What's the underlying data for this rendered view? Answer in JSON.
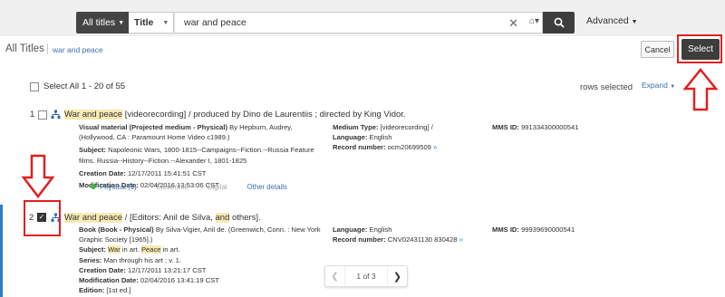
{
  "search": {
    "scope": "All titles",
    "field": "Title",
    "query": "war and peace",
    "advanced": "Advanced"
  },
  "header": {
    "title": "All Titles",
    "breadcrumb": "war and peace",
    "cancel": "Cancel",
    "select": "Select"
  },
  "toolbar": {
    "select_all": "Select All",
    "range": "1 - 20 of 55",
    "rows_selected": "rows selected",
    "expand": "Expand"
  },
  "records": [
    {
      "num": "1",
      "title_hl": "War and peace",
      "title_rest": " [videorecording] / produced by Dino de Laurentiis ; directed by King Vidor.",
      "type_label": "Visual material (Projected medium - Physical)",
      "type_rest": " By Hepburn, Audrey, (Hollywood, CA : Paramount Home Video c1989.)",
      "subject_label": "Subject:",
      "subject": " Napoleonic Wars, 1800-1815--Campaigns--Fiction.--Russia Feature films. Russia--History--Fiction.--Alexander I, 1801-1825",
      "creation_label": "Creation Date:",
      "creation": " 12/17/2011 15:41:51 CST",
      "mod_label": "Modification Date:",
      "mod": " 02/04/2016 13:53:06 CST",
      "medium_label": "Medium Type:",
      "medium": " [videorecording] /",
      "lang_label": "Language:",
      "lang": " English",
      "recnum_label": "Record number:",
      "recnum": " ocm20699509",
      "mms_label": "MMS ID:",
      "mms": " 991334300000541",
      "tab_physical": "Physical (1)",
      "tab_electronic": "Electronic",
      "tab_digital": "Digital",
      "tab_other": "Other details"
    },
    {
      "num": "2",
      "title_hl": "War and peace",
      "title_mid": " / [Editors: Anil de Silva, ",
      "title_and": "and",
      "title_end": " others].",
      "type_label": "Book (Book - Physical)",
      "type_rest": " By Silva-Vigier, Anil de. (Greenwich, Conn. : New York Graphic Society [1965].)",
      "subject_label": "Subject:",
      "subject_war": "War",
      "subject_mid": " in art. ",
      "subject_peace": "Peace",
      "subject_end": " in art.",
      "series_label": "Series:",
      "series": " Man through his art ; v. 1.",
      "creation_label": "Creation Date:",
      "creation": " 12/17/2011 13:21:17 CST",
      "mod_label": "Modification Date:",
      "mod": " 02/04/2016 13:41:19 CST",
      "edition_label": "Edition:",
      "edition": " [1st ed.]",
      "lang_label": "Language:",
      "lang": " English",
      "recnum_label": "Record number:",
      "recnum": " CNV02431130 830428",
      "mms_label": "MMS ID:",
      "mms": " 99939690000541"
    }
  ],
  "pager": {
    "text": "1 of 3"
  },
  "colors": {
    "accent": "#3a6fb0",
    "annotation": "#e02020",
    "highlight": "#f7e9b3"
  }
}
